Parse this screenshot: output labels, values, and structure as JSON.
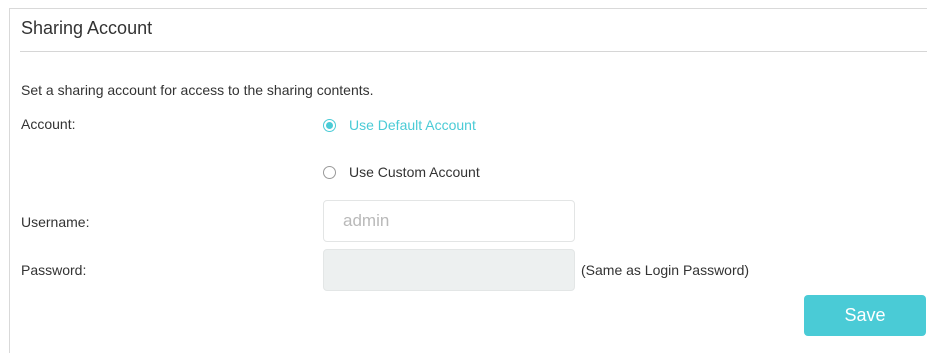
{
  "panel": {
    "title": "Sharing Account",
    "description": "Set a sharing account for access to the sharing contents."
  },
  "account": {
    "label": "Account:",
    "options": [
      {
        "label": "Use Default Account",
        "checked": true
      },
      {
        "label": "Use Custom Account",
        "checked": false
      }
    ]
  },
  "username": {
    "label": "Username:",
    "placeholder": "admin",
    "value": ""
  },
  "password": {
    "label": "Password:",
    "value": "",
    "hint": "(Same as Login Password)"
  },
  "actions": {
    "save_label": "Save"
  },
  "colors": {
    "accent": "#4acbd6",
    "disabled_field": "#edf0f0",
    "text": "#333333"
  }
}
